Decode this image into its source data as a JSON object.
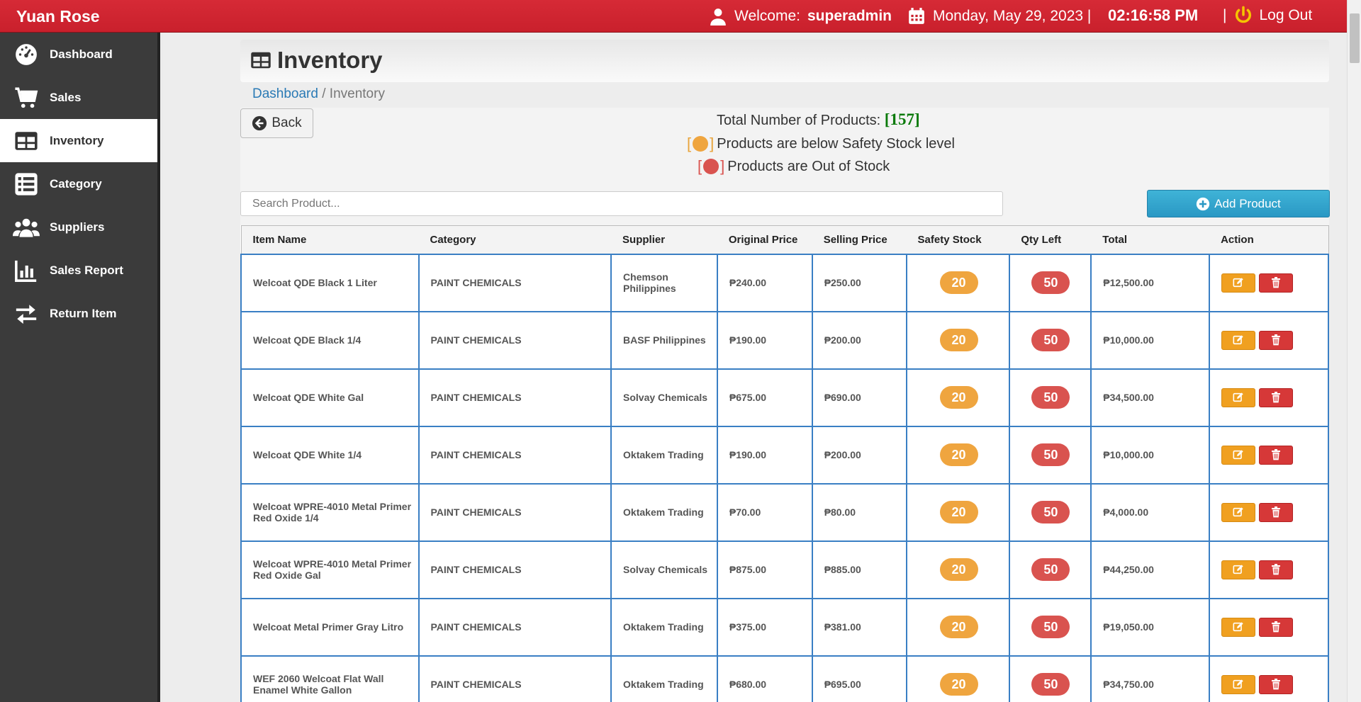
{
  "app": {
    "brand": "Yuan Rose"
  },
  "header": {
    "welcome_label": "Welcome:",
    "username": "superadmin",
    "date": "Monday, May 29, 2023 |",
    "time": "02:16:58 PM",
    "pipe": "|",
    "logout_label": "Log Out"
  },
  "sidebar": {
    "items": [
      {
        "label": "Dashboard",
        "icon": "dashboard-gauge-icon"
      },
      {
        "label": "Sales",
        "icon": "cart-icon"
      },
      {
        "label": "Inventory",
        "icon": "table-icon"
      },
      {
        "label": "Category",
        "icon": "list-icon"
      },
      {
        "label": "Suppliers",
        "icon": "users-icon"
      },
      {
        "label": "Sales Report",
        "icon": "bar-chart-icon"
      },
      {
        "label": "Return Item",
        "icon": "exchange-icon"
      }
    ],
    "active": "Inventory"
  },
  "page": {
    "title": "Inventory",
    "breadcrumb_home": "Dashboard",
    "breadcrumb_sep": " / ",
    "breadcrumb_current": "Inventory"
  },
  "toolbar": {
    "back_label": "Back",
    "add_label": "Add Product",
    "search_placeholder": "Search Product..."
  },
  "summary": {
    "total_label": "Total Number of Products:",
    "total_count": "[157]",
    "below_label": "Products are below Safety Stock level",
    "out_label": "Products are Out of Stock",
    "bracket_open": "[",
    "bracket_close": "]"
  },
  "colors": {
    "safety": "#efa53f",
    "out": "#d9534f",
    "accent": "#2a98c4",
    "topbar": "#d62a36"
  },
  "table": {
    "columns": [
      "Item Name",
      "Category",
      "Supplier",
      "Original Price",
      "Selling Price",
      "Safety Stock",
      "Qty Left",
      "Total",
      "Action"
    ],
    "rows": [
      {
        "name": "Welcoat QDE Black 1 Liter",
        "category": "PAINT CHEMICALS",
        "supplier": "Chemson Philippines",
        "orig": "₱240.00",
        "sell": "₱250.00",
        "safety": "20",
        "qty": "50",
        "total": "₱12,500.00"
      },
      {
        "name": "Welcoat QDE Black 1/4",
        "category": "PAINT CHEMICALS",
        "supplier": "BASF Philippines",
        "orig": "₱190.00",
        "sell": "₱200.00",
        "safety": "20",
        "qty": "50",
        "total": "₱10,000.00"
      },
      {
        "name": "Welcoat QDE White Gal",
        "category": "PAINT CHEMICALS",
        "supplier": "Solvay Chemicals",
        "orig": "₱675.00",
        "sell": "₱690.00",
        "safety": "20",
        "qty": "50",
        "total": "₱34,500.00"
      },
      {
        "name": "Welcoat QDE White 1/4",
        "category": "PAINT CHEMICALS",
        "supplier": "Oktakem Trading",
        "orig": "₱190.00",
        "sell": "₱200.00",
        "safety": "20",
        "qty": "50",
        "total": "₱10,000.00"
      },
      {
        "name": "Welcoat WPRE-4010 Metal Primer Red Oxide 1/4",
        "category": "PAINT CHEMICALS",
        "supplier": "Oktakem Trading",
        "orig": "₱70.00",
        "sell": "₱80.00",
        "safety": "20",
        "qty": "50",
        "total": "₱4,000.00"
      },
      {
        "name": "Welcoat WPRE-4010 Metal Primer Red Oxide Gal",
        "category": "PAINT CHEMICALS",
        "supplier": "Solvay Chemicals",
        "orig": "₱875.00",
        "sell": "₱885.00",
        "safety": "20",
        "qty": "50",
        "total": "₱44,250.00"
      },
      {
        "name": "Welcoat Metal Primer Gray Litro",
        "category": "PAINT CHEMICALS",
        "supplier": "Oktakem Trading",
        "orig": "₱375.00",
        "sell": "₱381.00",
        "safety": "20",
        "qty": "50",
        "total": "₱19,050.00"
      },
      {
        "name": "WEF 2060 Welcoat Flat Wall Enamel White Gallon",
        "category": "PAINT CHEMICALS",
        "supplier": "Oktakem Trading",
        "orig": "₱680.00",
        "sell": "₱695.00",
        "safety": "20",
        "qty": "50",
        "total": "₱34,750.00"
      }
    ]
  }
}
